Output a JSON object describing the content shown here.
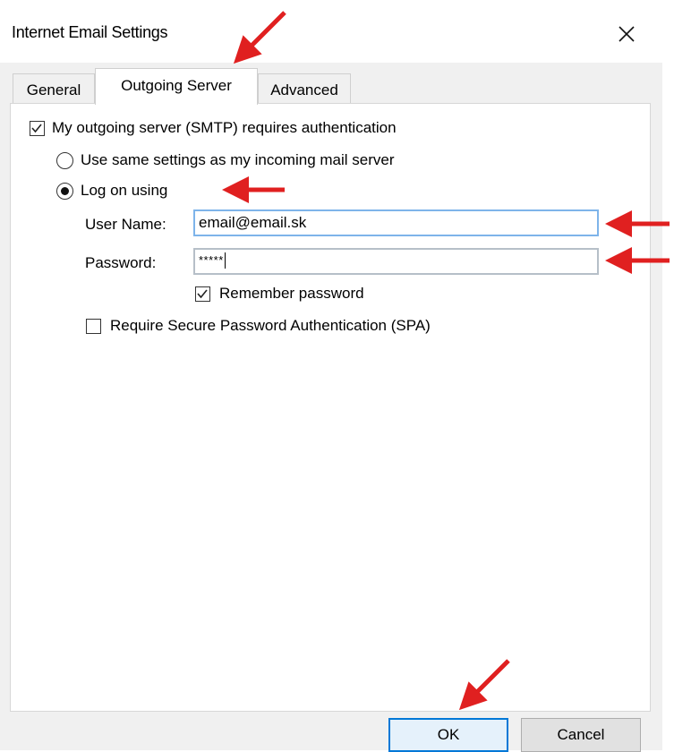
{
  "window": {
    "title": "Internet Email Settings",
    "close_glyph": "✕"
  },
  "tabs": [
    {
      "label": "General",
      "selected": false
    },
    {
      "label": "Outgoing Server",
      "selected": true
    },
    {
      "label": "Advanced",
      "selected": false
    }
  ],
  "outgoing": {
    "requires_auth_label": "My outgoing server (SMTP) requires authentication",
    "requires_auth_checked": true,
    "use_same_label": "Use same settings as my incoming mail server",
    "use_same_selected": false,
    "log_on_label": "Log on using",
    "log_on_selected": true,
    "username_label": "User Name:",
    "username_value": "email@email.sk",
    "password_label": "Password:",
    "password_value": "*****",
    "remember_label": "Remember password",
    "remember_checked": true,
    "spa_label": "Require Secure Password Authentication (SPA)",
    "spa_checked": false
  },
  "buttons": {
    "ok": "OK",
    "cancel": "Cancel"
  },
  "annotations": {
    "arrow_color": "#e02020"
  },
  "colors": {
    "focus_border": "#0078d7",
    "field_focus_border": "#7eb4ea"
  }
}
